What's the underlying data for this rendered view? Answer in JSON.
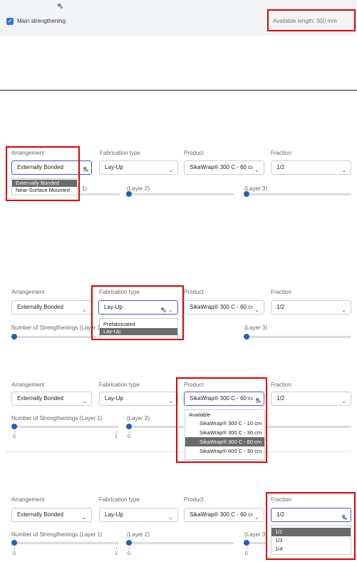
{
  "top": {
    "checkbox_label": "Main strengthening",
    "available_length": "Available length: 300 mm"
  },
  "labels": {
    "arrangement": "Arrangement",
    "fabrication_type": "Fabrication type",
    "product": "Product",
    "fraction": "Fraction",
    "num_layer1": "Number of Strengthenings (Layer 1)",
    "layer1_partial": "r 1)",
    "layer2": "(Layer 2)",
    "layer3": "(Layer 3)"
  },
  "values": {
    "arrangement": "Externally Bonded",
    "fabrication": "Lay-Up",
    "product": "SikaWrap® 300 C - 60 cı",
    "fraction": "1/2"
  },
  "slider_numbers": {
    "zero": "0",
    "one": "1"
  },
  "dropdowns": {
    "arrangement": [
      "Externally Bonded",
      "Near-Surface Mounted"
    ],
    "fabrication": [
      "Prefabricated",
      "Lay-Up"
    ],
    "product_group": "Available",
    "product": [
      "SikaWrap® 300 C - 10 cm",
      "SikaWrap® 300 C - 30 cm",
      "SikaWrap® 300 C - 60 cm",
      "SikaWrap® 600 C - 30 cm"
    ],
    "fraction": [
      "1/2",
      "1/3",
      "1/4"
    ]
  },
  "icons": {
    "checkbox": "checkbox-checked-icon",
    "chevron": "chevron-down-icon",
    "cursor": "mouse-pointer-icon"
  },
  "colors": {
    "highlight": "#e00000",
    "accent": "#4a57c8",
    "knob": "#1f5fbf",
    "selected_option": "#6b6b6b"
  }
}
